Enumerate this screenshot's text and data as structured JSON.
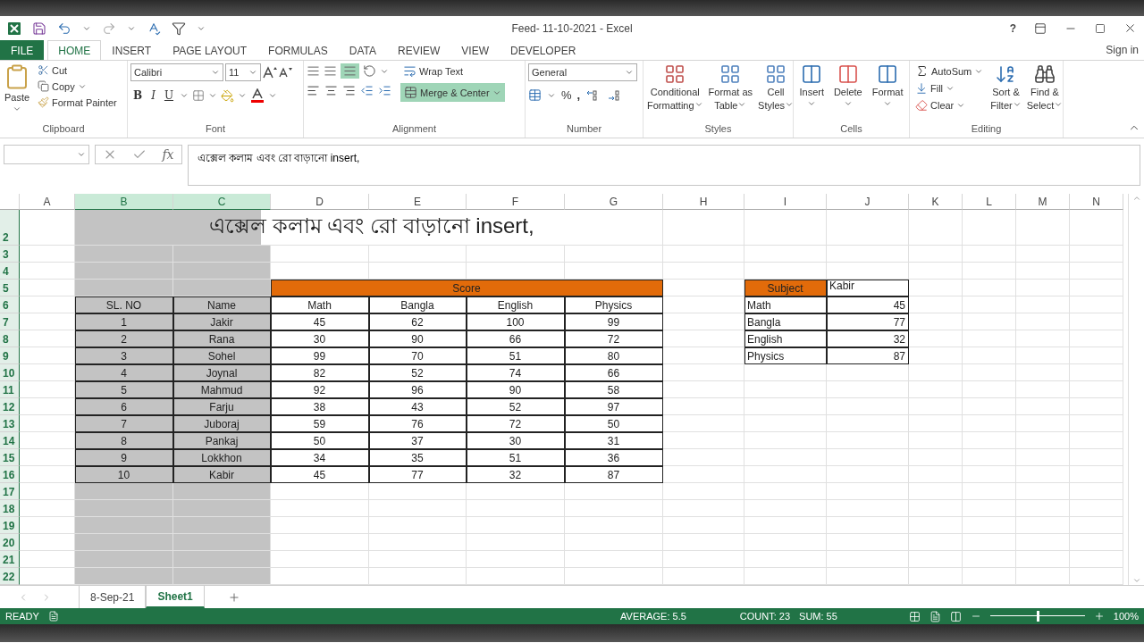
{
  "window": {
    "title": "Feed- 11-10-2021 - Excel",
    "help": "?"
  },
  "ribbon_tabs": [
    {
      "label": "FILE",
      "kind": "file",
      "selected": false
    },
    {
      "label": "HOME",
      "kind": "tab",
      "selected": true
    },
    {
      "label": "INSERT",
      "kind": "tab",
      "selected": false
    },
    {
      "label": "PAGE LAYOUT",
      "kind": "tab",
      "selected": false
    },
    {
      "label": "FORMULAS",
      "kind": "tab",
      "selected": false
    },
    {
      "label": "DATA",
      "kind": "tab",
      "selected": false
    },
    {
      "label": "REVIEW",
      "kind": "tab",
      "selected": false
    },
    {
      "label": "VIEW",
      "kind": "tab",
      "selected": false
    },
    {
      "label": "DEVELOPER",
      "kind": "tab",
      "selected": false
    }
  ],
  "sign_in": "Sign in",
  "clipboard": {
    "paste": "Paste",
    "cut": "Cut",
    "copy": "Copy",
    "format_painter": "Format Painter",
    "label": "Clipboard"
  },
  "font": {
    "name": "Calibri",
    "size": "11",
    "bold": "B",
    "italic": "I",
    "underline": "U",
    "label": "Font"
  },
  "alignment": {
    "wrap_text": "Wrap Text",
    "merge_center": "Merge & Center",
    "merge_selected": true,
    "bottom_align_selected": true,
    "label": "Alignment"
  },
  "number": {
    "format": "General",
    "percent": "%",
    "comma": ",",
    "label": "Number"
  },
  "styles": {
    "items": [
      {
        "lines": [
          "Conditional",
          "Formatting"
        ]
      },
      {
        "lines": [
          "Format as",
          "Table"
        ]
      },
      {
        "lines": [
          "Cell",
          "Styles"
        ]
      }
    ],
    "label": "Styles"
  },
  "cells": {
    "items": [
      {
        "label": "Insert"
      },
      {
        "label": "Delete"
      },
      {
        "label": "Format"
      }
    ],
    "label": "Cells"
  },
  "editing": {
    "autosum": "AutoSum",
    "fill": "Fill",
    "clear": "Clear",
    "sort": [
      "Sort &",
      "Filter"
    ],
    "find": [
      "Find &",
      "Select"
    ],
    "label": "Editing"
  },
  "formula_bar": {
    "fx": "fx",
    "value": "এক্সেল কলাম এবং রো বাড়ানো insert,"
  },
  "columns": [
    {
      "label": "A",
      "selected": false
    },
    {
      "label": "B",
      "selected": true
    },
    {
      "label": "C",
      "selected": true
    },
    {
      "label": "D",
      "selected": false
    },
    {
      "label": "E",
      "selected": false
    },
    {
      "label": "F",
      "selected": false
    },
    {
      "label": "G",
      "selected": false
    },
    {
      "label": "H",
      "selected": false
    },
    {
      "label": "I",
      "selected": false
    },
    {
      "label": "J",
      "selected": false
    },
    {
      "label": "K",
      "selected": false
    },
    {
      "label": "L",
      "selected": false
    },
    {
      "label": "M",
      "selected": false
    },
    {
      "label": "N",
      "selected": false
    }
  ],
  "rows": [
    {
      "label": "2",
      "selected": true
    },
    {
      "label": "3",
      "selected": true
    },
    {
      "label": "4",
      "selected": true
    },
    {
      "label": "5",
      "selected": true
    },
    {
      "label": "6",
      "selected": true
    },
    {
      "label": "7",
      "selected": true
    },
    {
      "label": "8",
      "selected": true
    },
    {
      "label": "9",
      "selected": true
    },
    {
      "label": "10",
      "selected": true
    },
    {
      "label": "11",
      "selected": true
    },
    {
      "label": "12",
      "selected": true
    },
    {
      "label": "13",
      "selected": true
    },
    {
      "label": "14",
      "selected": true
    },
    {
      "label": "15",
      "selected": true
    },
    {
      "label": "16",
      "selected": true
    },
    {
      "label": "17",
      "selected": true
    },
    {
      "label": "18",
      "selected": true
    },
    {
      "label": "19",
      "selected": true
    },
    {
      "label": "20",
      "selected": true
    },
    {
      "label": "21",
      "selected": true
    },
    {
      "label": "22",
      "selected": true
    }
  ],
  "title_cell": "এক্সেল কলাম এবং রো বাড়ানো insert,",
  "score_table": {
    "group_header": "Score",
    "columns": [
      "SL. NO",
      "Name",
      "Math",
      "Bangla",
      "English",
      "Physics"
    ],
    "rows": [
      [
        "1",
        "Jakir",
        "45",
        "62",
        "100",
        "99"
      ],
      [
        "2",
        "Rana",
        "30",
        "90",
        "66",
        "72"
      ],
      [
        "3",
        "Sohel",
        "99",
        "70",
        "51",
        "80"
      ],
      [
        "4",
        "Joynal",
        "82",
        "52",
        "74",
        "66"
      ],
      [
        "5",
        "Mahmud",
        "92",
        "96",
        "90",
        "58"
      ],
      [
        "6",
        "Farju",
        "38",
        "43",
        "52",
        "97"
      ],
      [
        "7",
        "Juboraj",
        "59",
        "76",
        "72",
        "50"
      ],
      [
        "8",
        "Pankaj",
        "50",
        "37",
        "30",
        "31"
      ],
      [
        "9",
        "Lokkhon",
        "34",
        "35",
        "51",
        "36"
      ],
      [
        "10",
        "Kabir",
        "45",
        "77",
        "32",
        "87"
      ]
    ]
  },
  "subject_table": {
    "header": "Subject",
    "student": "Kabir",
    "rows": [
      [
        "Math",
        "45"
      ],
      [
        "Bangla",
        "77"
      ],
      [
        "English",
        "32"
      ],
      [
        "Physics",
        "87"
      ]
    ]
  },
  "sheet_tabs": [
    {
      "label": "8-Sep-21",
      "selected": false
    },
    {
      "label": "Sheet1",
      "selected": true
    }
  ],
  "status_bar": {
    "mode": "READY",
    "average": "AVERAGE: 5.5",
    "count": "COUNT: 23",
    "sum": "SUM: 55",
    "zoom": "100%",
    "level": 0.5
  }
}
